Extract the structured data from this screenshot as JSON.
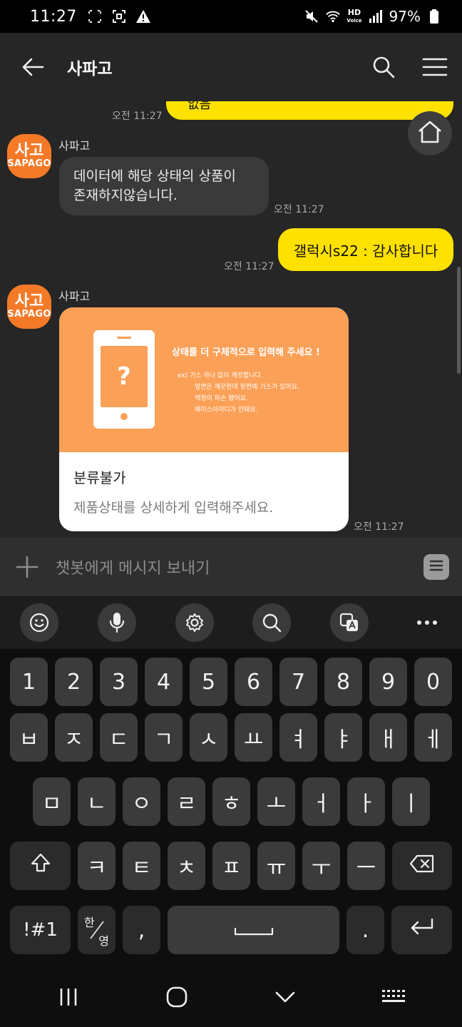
{
  "status_bar": {
    "time": "11:27",
    "battery": "97%",
    "icons": [
      "screenshot-icon",
      "scan-icon",
      "warning-icon",
      "mute-icon",
      "wifi-icon",
      "hd-voice-icon",
      "signal-icon",
      "battery-icon"
    ]
  },
  "header": {
    "title": "사파고",
    "back_icon": "arrow-left-icon",
    "search_icon": "search-icon",
    "menu_icon": "hamburger-icon"
  },
  "messages": [
    {
      "type": "user",
      "text": "없음",
      "time": "오전 11:27"
    },
    {
      "type": "bot",
      "sender": "사파고",
      "text_lines": [
        "데이터에 해당 상태의 상품이",
        "존재하지않습니다."
      ],
      "time": "오전 11:27"
    },
    {
      "type": "user",
      "text": "갤럭시s22 : 감사합니다",
      "time": "오전 11:27"
    },
    {
      "type": "bot_card",
      "sender": "사파고",
      "time": "오전 11:27",
      "banner": {
        "headline": "상태를 더 구체적으로 입력해 주세요 !",
        "examples": [
          "ex) 기스 하나 없이 깨끗합니다.",
          "앞면은 깨끗한데 뒷판에 기스가 있어요.",
          "액정이 파손 됐어요.",
          "페이스아이디가 안돼요."
        ],
        "phone_symbol": "?"
      },
      "title": "분류불가",
      "description": "제품상태를 상세하게 입력해주세요."
    }
  ],
  "avatar": {
    "logo_top": "사고",
    "logo_bottom": "SAPAGO"
  },
  "home_icon": "home-icon",
  "input": {
    "placeholder": "챗봇에게 메시지 보내기",
    "plus_icon": "plus-icon",
    "menu_icon": "list-icon"
  },
  "keyboard_toolbar": [
    "emoji-icon",
    "mic-icon",
    "settings-icon",
    "search-icon",
    "translate-icon",
    "more-icon"
  ],
  "keyboard": {
    "row1": [
      "1",
      "2",
      "3",
      "4",
      "5",
      "6",
      "7",
      "8",
      "9",
      "0"
    ],
    "row2": [
      "ㅂ",
      "ㅈ",
      "ㄷ",
      "ㄱ",
      "ㅅ",
      "ㅛ",
      "ㅕ",
      "ㅑ",
      "ㅐ",
      "ㅔ"
    ],
    "row3": [
      "ㅁ",
      "ㄴ",
      "ㅇ",
      "ㄹ",
      "ㅎ",
      "ㅗ",
      "ㅓ",
      "ㅏ",
      "ㅣ"
    ],
    "row4": [
      "ㅋ",
      "ㅌ",
      "ㅊ",
      "ㅍ",
      "ㅠ",
      "ㅜ",
      "ㅡ"
    ],
    "symbols_label": "!#1",
    "lang_top": "한",
    "lang_bottom": "영",
    "comma": ",",
    "period": "."
  },
  "nav_bar": [
    "recents-icon",
    "home-circle-icon",
    "back-chevron-icon",
    "keyboard-icon"
  ]
}
